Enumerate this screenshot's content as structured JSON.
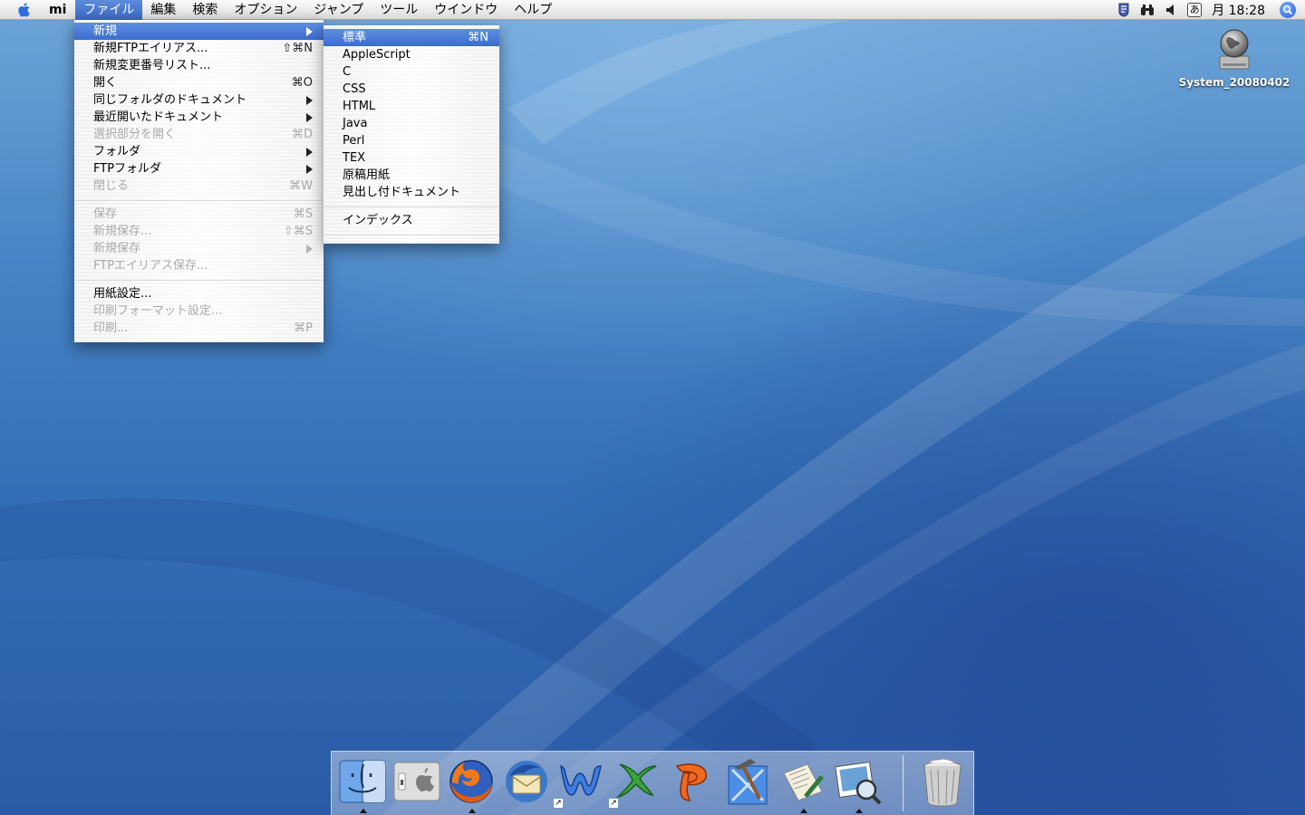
{
  "menubar": {
    "app_name": "mi",
    "menus": [
      "ファイル",
      "編集",
      "検索",
      "オプション",
      "ジャンプ",
      "ツール",
      "ウインドウ",
      "ヘルプ"
    ],
    "active_menu": "ファイル",
    "clock": "月 18:28",
    "input_method": "あ",
    "icons": [
      "apple-logo-icon",
      "script-menu-icon",
      "binoculars-icon",
      "volume-icon",
      "input-method-icon",
      "spotlight-icon"
    ]
  },
  "file_menu": {
    "items": [
      {
        "label": "新規",
        "shortcut": "",
        "submenu": true,
        "highlighted": true,
        "enabled": true
      },
      {
        "label": "新規FTPエイリアス...",
        "shortcut": "⇧⌘N",
        "enabled": true
      },
      {
        "label": "新規変更番号リスト...",
        "shortcut": "",
        "enabled": true
      },
      {
        "label": "開く",
        "shortcut": "⌘O",
        "enabled": true
      },
      {
        "label": "同じフォルダのドキュメント",
        "shortcut": "",
        "submenu": true,
        "enabled": true
      },
      {
        "label": "最近開いたドキュメント",
        "shortcut": "",
        "submenu": true,
        "enabled": true
      },
      {
        "label": "選択部分を開く",
        "shortcut": "⌘D",
        "enabled": false
      },
      {
        "label": "フォルダ",
        "shortcut": "",
        "submenu": true,
        "enabled": true
      },
      {
        "label": "FTPフォルダ",
        "shortcut": "",
        "submenu": true,
        "enabled": true
      },
      {
        "label": "閉じる",
        "shortcut": "⌘W",
        "enabled": false
      },
      {
        "label": "保存",
        "shortcut": "⌘S",
        "enabled": false
      },
      {
        "label": "新規保存...",
        "shortcut": "⇧⌘S",
        "enabled": false
      },
      {
        "label": "新規保存",
        "shortcut": "",
        "submenu": true,
        "enabled": false
      },
      {
        "label": "FTPエイリアス保存...",
        "shortcut": "",
        "enabled": false
      },
      {
        "label": "用紙設定...",
        "shortcut": "",
        "enabled": true
      },
      {
        "label": "印刷フォーマット設定...",
        "shortcut": "",
        "enabled": false
      },
      {
        "label": "印刷...",
        "shortcut": "⌘P",
        "enabled": false
      }
    ]
  },
  "new_submenu": {
    "items": [
      {
        "label": "標準",
        "shortcut": "⌘N",
        "highlighted": true
      },
      {
        "label": "AppleScript",
        "shortcut": ""
      },
      {
        "label": "C",
        "shortcut": ""
      },
      {
        "label": "CSS",
        "shortcut": ""
      },
      {
        "label": "HTML",
        "shortcut": ""
      },
      {
        "label": "Java",
        "shortcut": ""
      },
      {
        "label": "Perl",
        "shortcut": ""
      },
      {
        "label": "TEX",
        "shortcut": ""
      },
      {
        "label": "原稿用紙",
        "shortcut": ""
      },
      {
        "label": "見出し付ドキュメント",
        "shortcut": ""
      },
      {
        "label": "インデックス",
        "shortcut": ""
      }
    ]
  },
  "desktop": {
    "hard_drive_label": "System_20080402"
  },
  "dock": {
    "items": [
      {
        "name": "finder-icon",
        "running": true
      },
      {
        "name": "system-preferences-icon",
        "running": false
      },
      {
        "name": "firefox-icon",
        "running": true
      },
      {
        "name": "thunderbird-icon",
        "running": false
      },
      {
        "name": "word-icon",
        "running": false,
        "alias": true
      },
      {
        "name": "excel-icon",
        "running": false,
        "alias": true
      },
      {
        "name": "powerpoint-icon",
        "running": false
      },
      {
        "name": "xcode-icon",
        "running": false
      },
      {
        "name": "mi-editor-icon",
        "running": true
      },
      {
        "name": "preview-icon",
        "running": true
      },
      {
        "name": "trash-icon",
        "running": false
      }
    ]
  },
  "colors": {
    "highlight": "#3b6ccf",
    "wallpaper": "#336fb6"
  }
}
